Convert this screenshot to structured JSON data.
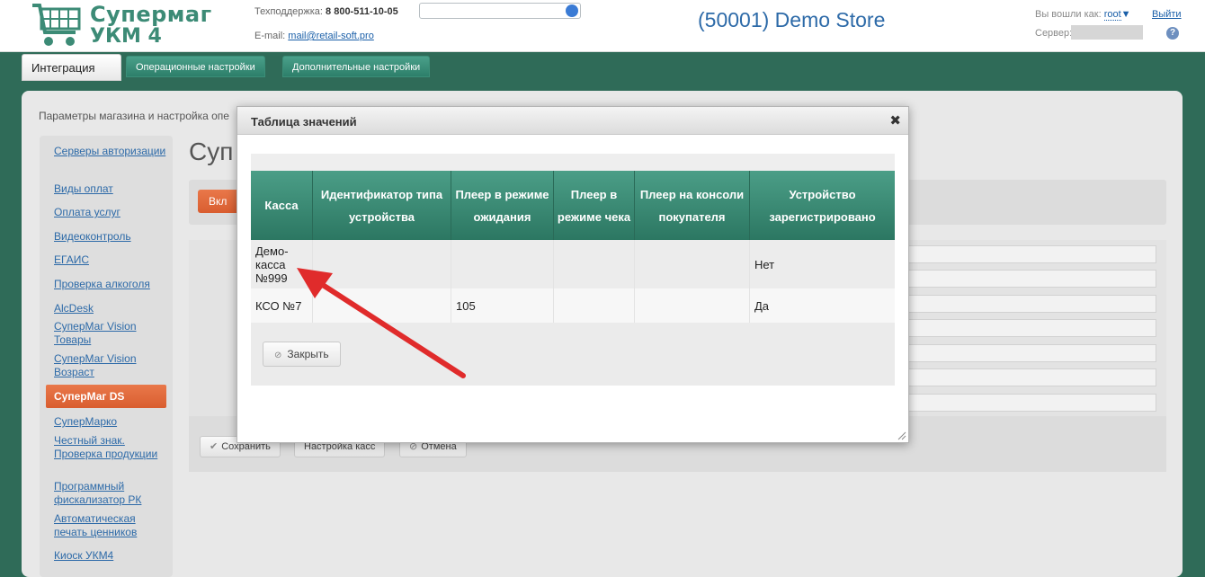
{
  "header": {
    "logo_line1": "Супермаг",
    "logo_line2": "УКМ 4",
    "support_label": "Техподдержка:",
    "support_phone": "8 800-511-10-05",
    "email_label": "E-mail:",
    "email_value": "mail@retail-soft.pro",
    "store_title": "(50001) Demo Store",
    "login_label": "Вы вошли как:",
    "login_user": "root",
    "logout_label": "Выйти",
    "server_label": "Сервер:"
  },
  "tabs": [
    {
      "label": "Интеграция"
    },
    {
      "label": "Операционные настройки"
    },
    {
      "label": "Дополнительные настройки"
    }
  ],
  "breadcrumb": "Параметры магазина и настройка опе",
  "sidebar": {
    "items": [
      {
        "label": "Серверы авторизации"
      },
      {
        "label": "Виды оплат"
      },
      {
        "label": "Оплата услуг"
      },
      {
        "label": "Видеоконтроль"
      },
      {
        "label": "ЕГАИС"
      },
      {
        "label": "Проверка алкоголя"
      },
      {
        "label": "AlcDesk"
      },
      {
        "label": "СуперМаг Vision Товары"
      },
      {
        "label": "СуперМаг Vision Возраст"
      },
      {
        "label": "СуперМаг DS"
      },
      {
        "label": "СуперМарко"
      },
      {
        "label": "Честный знак. Проверка продукции"
      },
      {
        "label": "Программный фискализатор РК"
      },
      {
        "label": "Автоматическая печать ценников"
      },
      {
        "label": "Киоск УКМ4"
      }
    ]
  },
  "content": {
    "title": "Суп",
    "toggle_label": "Вкл"
  },
  "buttons": {
    "save": "Сохранить",
    "cash_settings": "Настройка касс",
    "cancel": "Отмена"
  },
  "modal": {
    "title": "Таблица значений",
    "close_label": "Закрыть",
    "columns": [
      "Касса",
      "Идентификатор типа устройства",
      "Плеер в режиме ожидания",
      "Плеер в режиме чека",
      "Плеер на консоли покупателя",
      "Устройство зарегистрировано"
    ],
    "rows": [
      [
        "Демо-касса №999",
        "",
        "",
        "",
        "",
        "Нет"
      ],
      [
        "КСО №7",
        "",
        "105",
        "",
        "",
        "Да"
      ]
    ]
  }
}
